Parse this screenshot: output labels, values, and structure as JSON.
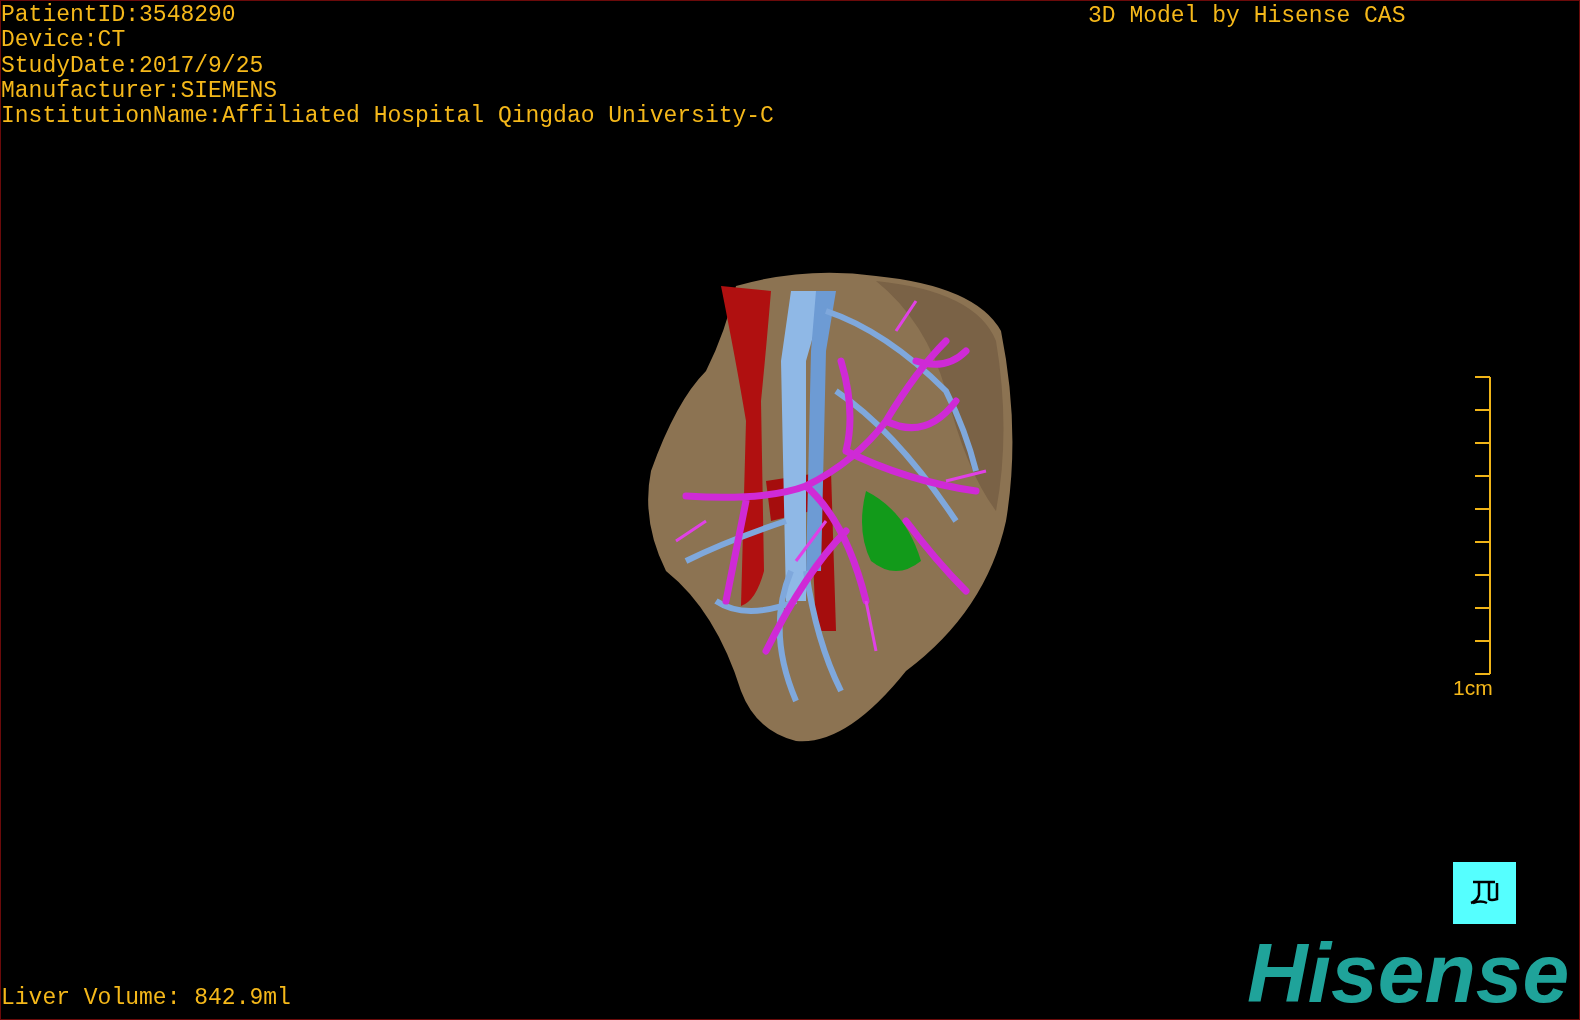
{
  "info_lines": [
    "PatientID:3548290",
    "Device:CT",
    "StudyDate:2017/9/25",
    "Manufacturer:SIEMENS",
    "InstitutionName:Affiliated Hospital Qingdao University-C"
  ],
  "title": "3D Model by Hisense CAS",
  "scale_bar": {
    "label": "1cm"
  },
  "liver_volume": "Liver Volume: 842.9ml",
  "logo": "Hisense"
}
